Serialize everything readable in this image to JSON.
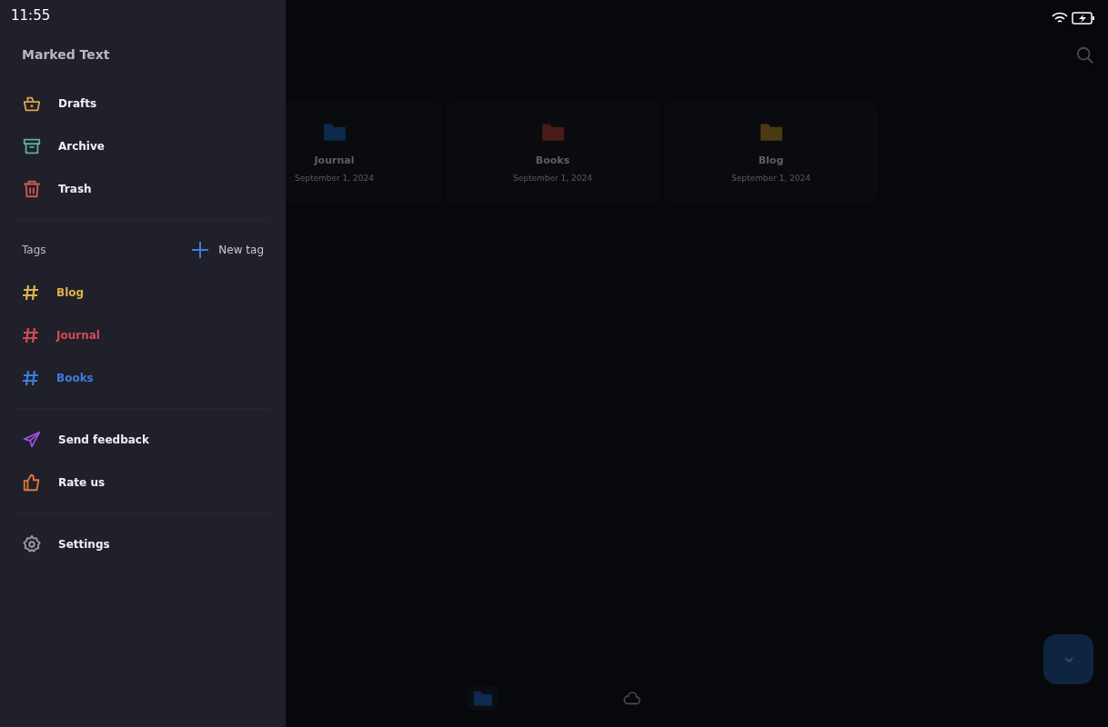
{
  "status_bar": {
    "time": "11:55"
  },
  "drawer": {
    "title": "Marked Text",
    "sections": [
      {
        "kind": "nav",
        "items": [
          {
            "label": "Drafts",
            "color": "#e0a14e"
          },
          {
            "label": "Archive",
            "color": "#5fae8c"
          },
          {
            "label": "Trash",
            "color": "#d0555a"
          }
        ]
      },
      {
        "kind": "tags",
        "heading": "Tags",
        "action": "New tag",
        "items": [
          {
            "label": "Blog",
            "color": "#e0b24e"
          },
          {
            "label": "Journal",
            "color": "#d24a57"
          },
          {
            "label": "Books",
            "color": "#3f7be0"
          }
        ]
      },
      {
        "kind": "nav",
        "items": [
          {
            "label": "Send feedback",
            "color": "#9a4fe0"
          },
          {
            "label": "Rate us",
            "color": "#e0773e"
          }
        ]
      },
      {
        "kind": "nav",
        "items": [
          {
            "label": "Settings",
            "color": "#9a9ba3"
          }
        ]
      }
    ]
  },
  "folders": [
    {
      "name": "Journal",
      "date": "September 1, 2024",
      "color": "#0d2a4a"
    },
    {
      "name": "Books",
      "date": "September 1, 2024",
      "color": "#4a1a16"
    },
    {
      "name": "Blog",
      "date": "September 1, 2024",
      "color": "#4a3a10"
    }
  ],
  "bottom_nav": [
    {
      "selected": true
    },
    {
      "selected": false
    }
  ]
}
